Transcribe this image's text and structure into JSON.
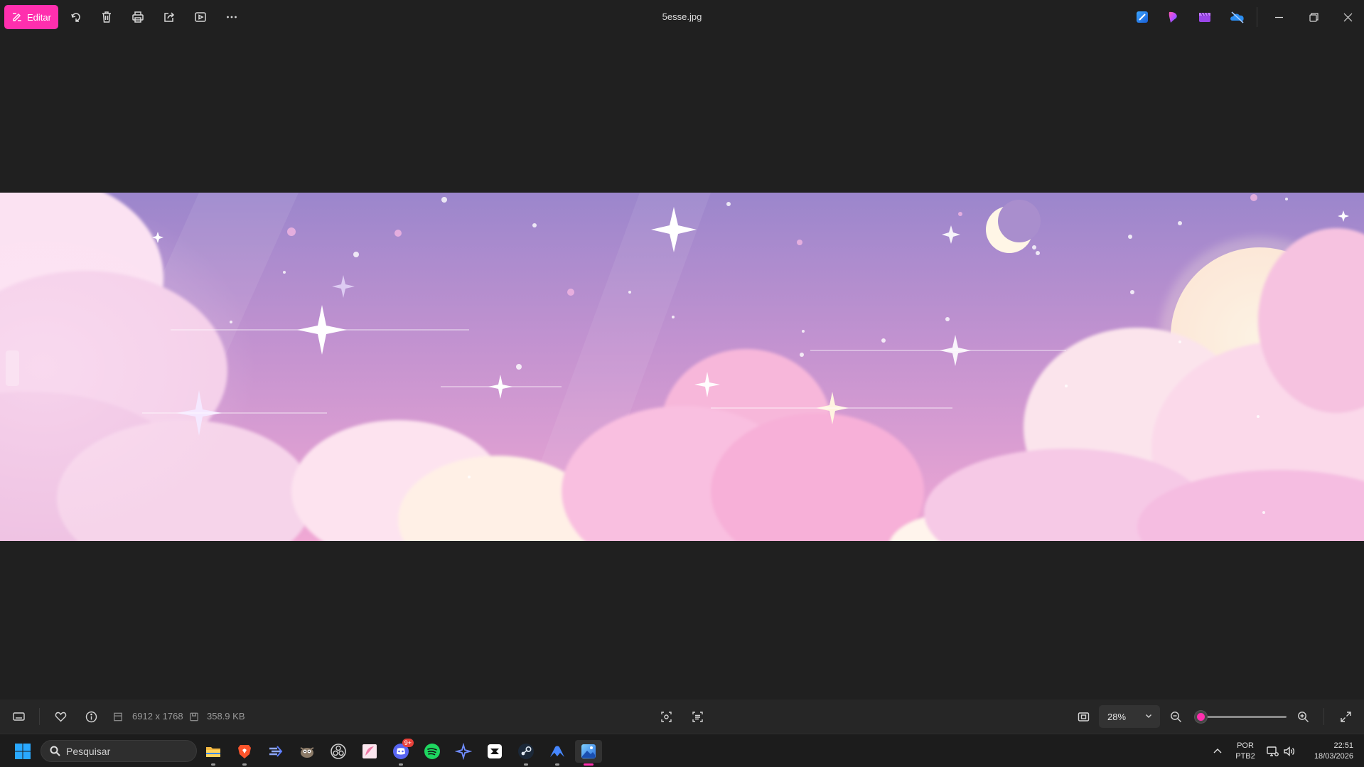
{
  "toolbar": {
    "edit_label": "Editar",
    "file_name": "5esse.jpg",
    "icons": [
      "edit-icon",
      "rotate-icon",
      "delete-icon",
      "print-icon",
      "share-icon",
      "slideshow-icon",
      "more-icon"
    ],
    "pinned_apps": [
      "photos-edit-icon",
      "clipchamp-icon",
      "video-editor-icon",
      "onedrive-offline-icon"
    ],
    "window_controls": [
      "minimize-icon",
      "restore-icon",
      "close-icon"
    ]
  },
  "status": {
    "dimensions": "6912 x 1768",
    "file_size": "358.9 KB",
    "zoom_label": "28%",
    "zoom_fraction": 0.07,
    "accent_color": "#ff2fae"
  },
  "taskbar": {
    "search_placeholder": "Pesquisar",
    "apps": [
      "file-explorer-icon",
      "brave-icon",
      "app-icon",
      "gimp-icon",
      "obs-icon",
      "mochi-icon",
      "discord-icon",
      "spotify-icon",
      "app-icon",
      "capcut-icon",
      "steam-icon",
      "nordvpn-icon",
      "photos-icon"
    ],
    "discord_badge": "9+",
    "language": "POR",
    "keyboard": "PTB2",
    "time": "22:51",
    "date": "18/03/2026"
  }
}
